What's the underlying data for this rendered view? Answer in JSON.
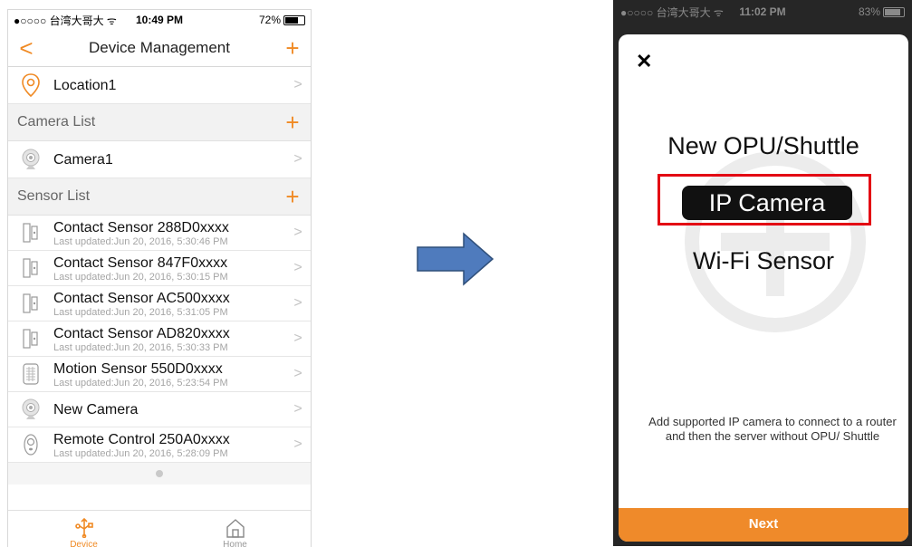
{
  "left": {
    "status": {
      "carrier": "●○○○○ 台湾大哥大 ᯤ",
      "time": "10:49 PM",
      "battery": "72%",
      "battery_level": 0.72
    },
    "nav": {
      "back": "<",
      "title": "Device Management",
      "add": "+"
    },
    "location": {
      "label": "Location1",
      "chevron": ">"
    },
    "camera_section": {
      "label": "Camera List",
      "add": "+"
    },
    "camera": {
      "label": "Camera1",
      "chevron": ">"
    },
    "sensor_section": {
      "label": "Sensor List",
      "add": "+"
    },
    "sensors": [
      {
        "name": "Contact Sensor 288D0xxxx",
        "updated": "Last updated:Jun 20, 2016, 5:30:46 PM",
        "icon": "contact-sensor-icon"
      },
      {
        "name": "Contact Sensor 847F0xxxx",
        "updated": "Last updated:Jun 20, 2016, 5:30:15 PM",
        "icon": "contact-sensor-icon"
      },
      {
        "name": "Contact Sensor AC500xxxx",
        "updated": "Last updated:Jun 20, 2016, 5:31:05 PM",
        "icon": "contact-sensor-icon"
      },
      {
        "name": "Contact Sensor AD820xxxx",
        "updated": "Last updated:Jun 20, 2016, 5:30:33 PM",
        "icon": "contact-sensor-icon"
      },
      {
        "name": "Motion Sensor 550D0xxxx",
        "updated": "Last updated:Jun 20, 2016, 5:23:54 PM",
        "icon": "motion-sensor-icon"
      },
      {
        "name": "New Camera",
        "updated": "",
        "icon": "camera-icon"
      },
      {
        "name": "Remote Control 250A0xxxx",
        "updated": "Last updated:Jun 20, 2016, 5:28:09 PM",
        "icon": "remote-control-icon"
      }
    ],
    "chevron": ">",
    "tabs": {
      "device": "Device",
      "home": "Home"
    }
  },
  "right": {
    "status": {
      "carrier": "●○○○○ 台湾大哥大 ᯤ",
      "time": "11:02 PM",
      "battery": "83%",
      "battery_level": 0.83
    },
    "close": "✕",
    "options": {
      "opu": "New OPU/Shuttle",
      "ip_camera": "IP Camera",
      "wifi_sensor": "Wi-Fi Sensor"
    },
    "description": "Add supported IP camera to connect to a router and then the server without OPU/ Shuttle",
    "next": "Next"
  },
  "colors": {
    "accent": "#ef8a2a",
    "highlight": "#e30613",
    "arrow": "#4f7bbd"
  }
}
